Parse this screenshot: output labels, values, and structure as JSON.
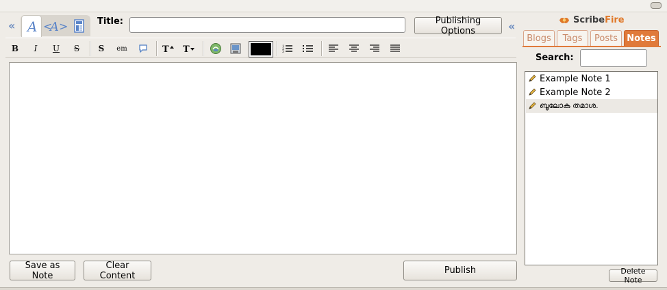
{
  "editor": {
    "title_label": "Title:",
    "title_value": "",
    "publishing_options_label": "Publishing Options",
    "save_as_note_label": "Save as Note",
    "clear_content_label": "Clear Content",
    "publish_label": "Publish",
    "body_text": "",
    "toolbar": {
      "bold": "B",
      "italic": "I",
      "underline": "U",
      "strike": "S",
      "strong": "S",
      "em": "em",
      "text_color": "#000000"
    }
  },
  "sidebar": {
    "logo": {
      "scribe": "Scribe",
      "fire": "Fire"
    },
    "tabs": [
      {
        "label": "Blogs",
        "active": false
      },
      {
        "label": "Tags",
        "active": false
      },
      {
        "label": "Posts",
        "active": false
      },
      {
        "label": "Notes",
        "active": true
      }
    ],
    "search_label": "Search:",
    "search_value": "",
    "notes": [
      {
        "label": "Example Note 1"
      },
      {
        "label": "Example Note 2"
      },
      {
        "label": "ബൂലോക തമാശ."
      }
    ],
    "delete_note_label": "Delete Note"
  },
  "colors": {
    "accent": "#e07a3a",
    "mode_icon": "#5a84c8",
    "background": "#efece7"
  },
  "icons": {
    "collapse_left": "double-chevron-left-icon",
    "rich_text_mode": "rich-text-icon",
    "html_mode": "html-code-icon",
    "preview_mode": "preview-page-icon",
    "link": "link-icon",
    "image": "image-icon",
    "ordered_list": "ordered-list-icon",
    "unordered_list": "unordered-list-icon",
    "align_left": "align-left-icon",
    "align_center": "align-center-icon",
    "align_right": "align-right-icon",
    "justify": "justify-icon",
    "pencil": "pencil-icon",
    "logo": "scribefire-logo-icon"
  }
}
